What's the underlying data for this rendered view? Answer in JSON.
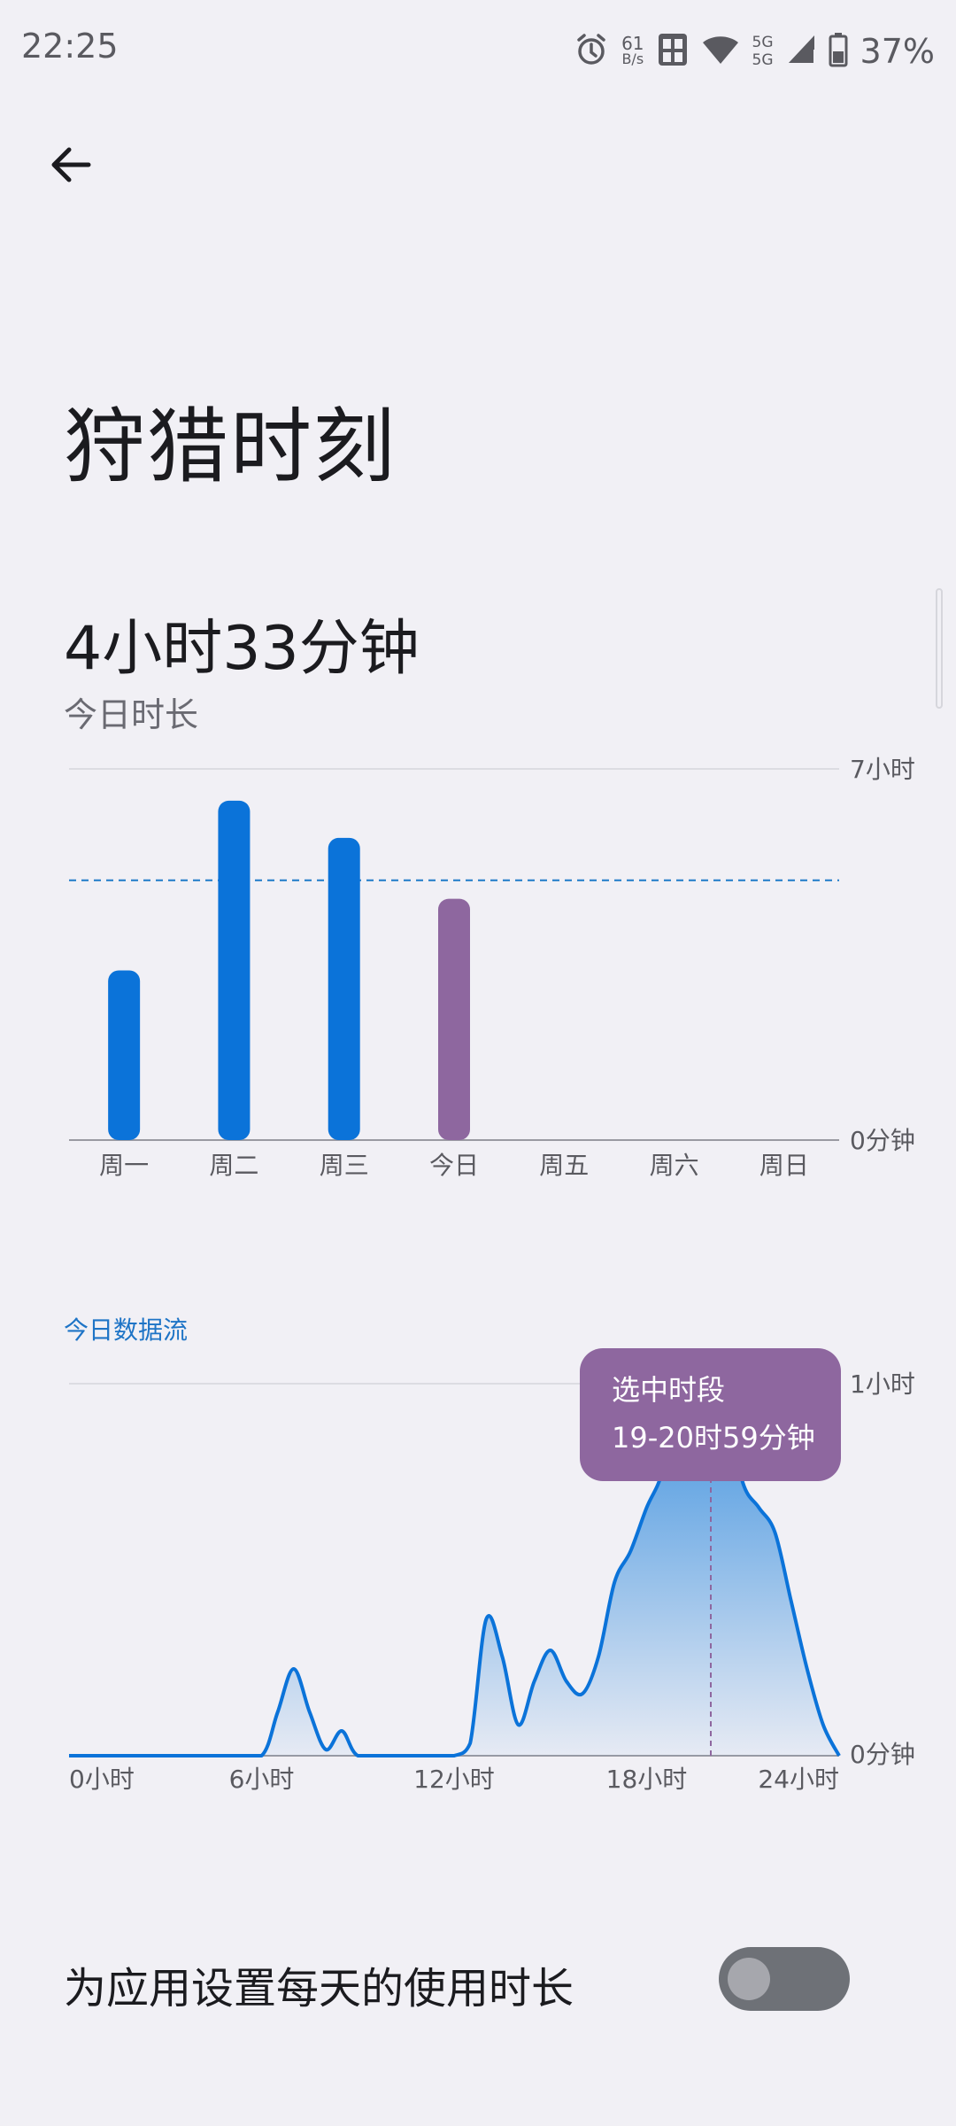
{
  "status_bar": {
    "time": "22:25",
    "net_speed_value": "61",
    "net_speed_unit": "B/s",
    "sig_top": "5G",
    "sig_bottom": "5G",
    "battery": "37%",
    "icons": [
      "alarm-icon",
      "sim-icon",
      "wifi-icon",
      "signal-icon",
      "battery-icon"
    ]
  },
  "header": {
    "back_icon": "arrow-left-icon"
  },
  "page": {
    "title": "狩猎时刻"
  },
  "summary": {
    "total_time": "4小时33分钟",
    "label": "今日时长"
  },
  "weekly_chart": {
    "y_top_label": "7小时",
    "y_bottom_label": "0分钟",
    "days": [
      "周一",
      "周二",
      "周三",
      "今日",
      "周五",
      "周六",
      "周日"
    ],
    "colors": {
      "normal": "#0b73d9",
      "today": "#8e679f",
      "average_line": "#1e7ac8"
    }
  },
  "hourly_section_label": "今日数据流",
  "hourly_chart": {
    "y_top_label": "1小时",
    "y_bottom_label": "0分钟",
    "x_labels": [
      "0小时",
      "6小时",
      "12小时",
      "18小时",
      "24小时"
    ],
    "colors": {
      "line": "#0b73d9",
      "fill_top": "#3f92df",
      "marker": "#8e679f"
    }
  },
  "tooltip": {
    "title": "选中时段",
    "detail": "19-20时59分钟"
  },
  "setting": {
    "label": "为应用设置每天的使用时长",
    "toggle_on": false
  },
  "chart_data": [
    {
      "type": "bar",
      "categories": [
        "周一",
        "周二",
        "周三",
        "今日",
        "周五",
        "周六",
        "周日"
      ],
      "values": [
        3.2,
        6.4,
        5.7,
        4.55,
        0,
        0,
        0
      ],
      "ylim": [
        0,
        7
      ],
      "y_tick_labels": [
        "0分钟",
        "7小时"
      ],
      "average_line": 4.9,
      "highlight": "今日"
    },
    {
      "type": "area",
      "x": [
        0,
        1,
        2,
        3,
        4,
        5,
        6,
        6.5,
        7,
        7.5,
        8,
        8.5,
        9,
        10,
        10.5,
        11,
        11.5,
        12,
        12.5,
        13,
        13.5,
        14,
        14.5,
        15,
        15.5,
        16,
        16.5,
        17,
        17.5,
        18,
        18.5,
        19,
        19.5,
        20,
        20.5,
        21,
        21.5,
        22,
        22.5,
        23,
        23.5,
        24
      ],
      "values": [
        0,
        0,
        0,
        0,
        0,
        0,
        0,
        7,
        14,
        7,
        1,
        4,
        0,
        0,
        0,
        0,
        0,
        0,
        2,
        22,
        16,
        5,
        12,
        17,
        12,
        10,
        16,
        28,
        33,
        40,
        46,
        59,
        59,
        59,
        56,
        44,
        40,
        36,
        25,
        14,
        5,
        0
      ],
      "ylim": [
        0,
        60
      ],
      "y_tick_labels": [
        "0分钟",
        "1小时"
      ],
      "x_tick_labels": [
        "0小时",
        "6小时",
        "12小时",
        "18小时",
        "24小时"
      ],
      "selected_range": "19-20",
      "selected_value": 59
    }
  ]
}
